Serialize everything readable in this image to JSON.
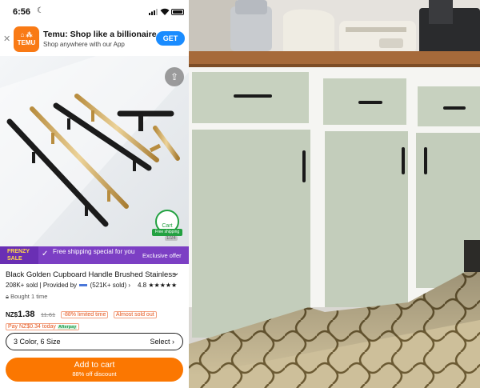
{
  "status_bar": {
    "time": "6:56"
  },
  "app_banner": {
    "logo_text": "TEMU",
    "title": "Temu: Shop like a billionaire",
    "subtitle": "Shop anywhere with our App",
    "get_label": "GET"
  },
  "product_image": {
    "cart_badge_label": "Cart",
    "free_shipping_badge": "Free shipping",
    "page_counter": "1/24"
  },
  "promo_strip": {
    "frenzy_line1": "FRENZY",
    "frenzy_line2": "SALE",
    "message": "Free shipping special for you",
    "exclusive": "Exclusive offer"
  },
  "product": {
    "title": "Black Golden Cupboard Handle Brushed Stainless",
    "sold": "208K+ sold",
    "provided_by": "Provided by",
    "seller_sold": "(521K+ sold)",
    "rating": "4.8",
    "stars": 5,
    "bought": "Bought 1 time",
    "currency": "NZ$",
    "price": "1.38",
    "old_price": "11.61",
    "discount_tag": "-88% limited time",
    "stock_tag": "Almost sold out",
    "pay_today": "Pay NZ$0.34 today",
    "pay_badge": "Afterpay"
  },
  "variant_selector": {
    "summary": "3 Color, 6 Size",
    "action": "Select"
  },
  "add_to_cart": {
    "label": "Add to cart",
    "sub": "88% off discount"
  },
  "colors": {
    "temu_orange": "#fb7701",
    "frenzy_purple": "#7c3fc4",
    "get_blue": "#1a8cff",
    "cabinet_green": "#c6d0be",
    "countertop_wood": "#a66a3a"
  }
}
